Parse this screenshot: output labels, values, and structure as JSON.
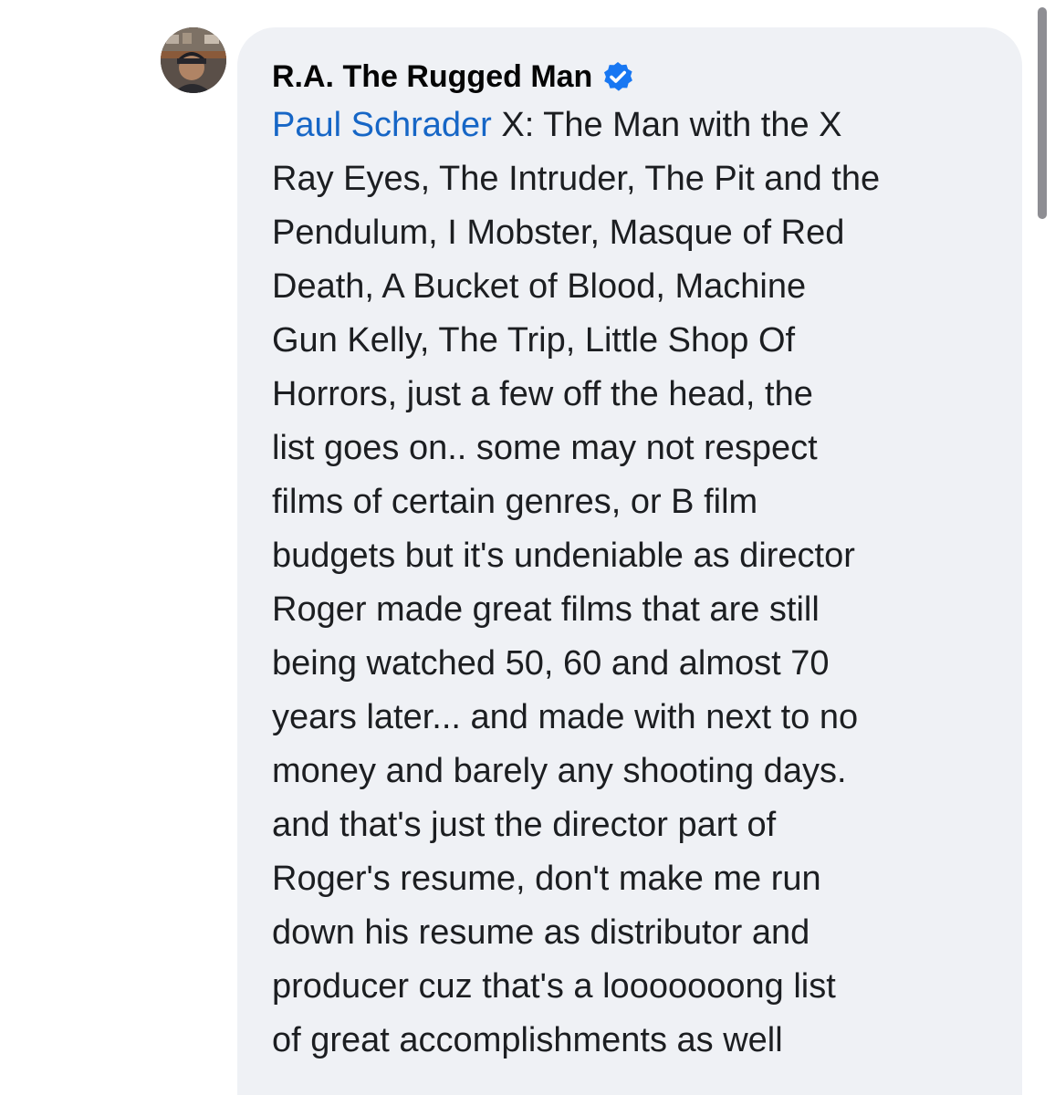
{
  "comment": {
    "author": "R.A. The Rugged Man",
    "author_verified": true,
    "mention": "Paul Schrader",
    "text": " X: The Man with the X\nRay Eyes, The Intruder, The Pit and the\nPendulum, I Mobster, Masque of Red\nDeath, A Bucket of Blood, Machine\nGun Kelly, The Trip, Little Shop Of\nHorrors,  just a few off the head, the\nlist goes on.. some may not respect\nfilms of certain genres, or B film\nbudgets but it's undeniable as director\nRoger made great films that are still\nbeing watched 50, 60 and almost 70\nyears later... and made with next to no\nmoney and barely any shooting days.\nand that's just the director part of\nRoger's resume, don't make me run\ndown his resume as distributor and\nproducer cuz that's a looooooong list\nof great accomplishments as well"
  },
  "icons": {
    "avatar": "profile-photo",
    "verified": "verified-badge-icon"
  },
  "colors": {
    "bubble": "#eff1f5",
    "mention": "#1666c6",
    "verified": "#1877f2",
    "text": "#1c1e21"
  }
}
